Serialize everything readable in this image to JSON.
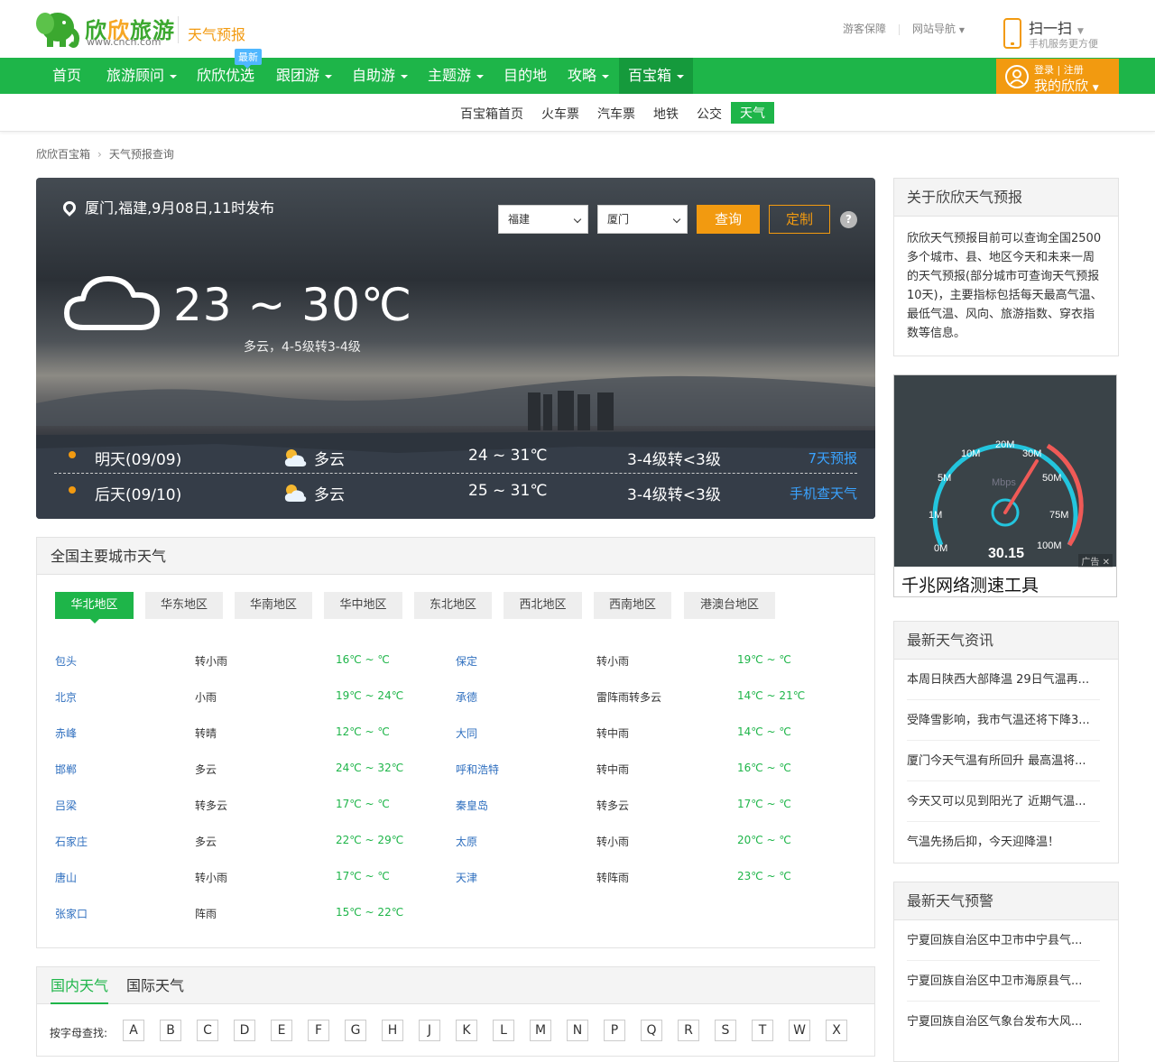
{
  "brand": {
    "name": "欣欣旅游",
    "url": "www.cncn.com",
    "section": "天气预报"
  },
  "top_links": [
    "游客保障",
    "网站导航"
  ],
  "scan": {
    "title": "扫一扫",
    "sub": "手机服务更方便"
  },
  "nav": {
    "items": [
      "首页",
      "旅游顾问",
      "欣欣优选",
      "跟团游",
      "自助游",
      "主题游",
      "目的地",
      "攻略",
      "百宝箱"
    ],
    "badge": "最新"
  },
  "login": {
    "line1": "登录 | 注册",
    "line2": "我的欣欣"
  },
  "subnav": [
    "百宝箱首页",
    "火车票",
    "汽车票",
    "地铁",
    "公交",
    "天气"
  ],
  "breadcrumb": [
    "欣欣百宝箱",
    "天气预报查询"
  ],
  "hero": {
    "location": "厦门,福建,9月08日,11时发布",
    "province": "福建",
    "city": "厦门",
    "query_label": "查询",
    "custom_label": "定制",
    "help": "?",
    "temp": "23 ~ 30℃",
    "desc": "多云，4-5级转3-4级",
    "forecast": [
      {
        "day": "明天(09/09)",
        "weather": "多云",
        "range": "24 ~ 31℃",
        "wind": "3-4级转<3级",
        "link": "7天预报"
      },
      {
        "day": "后天(09/10)",
        "weather": "多云",
        "range": "25 ~ 31℃",
        "wind": "3-4级转<3级",
        "link": "手机查天气"
      }
    ]
  },
  "city_panel": {
    "title": "全国主要城市天气",
    "tabs": [
      "华北地区",
      "华东地区",
      "华南地区",
      "华中地区",
      "东北地区",
      "西北地区",
      "西南地区",
      "港澳台地区"
    ],
    "rows": [
      [
        {
          "city": "包头",
          "weather": "转小雨",
          "temp": "16℃ ~ ℃"
        },
        {
          "city": "保定",
          "weather": "转小雨",
          "temp": "19℃ ~ ℃"
        }
      ],
      [
        {
          "city": "北京",
          "weather": "小雨",
          "temp": "19℃ ~ 24℃"
        },
        {
          "city": "承德",
          "weather": "雷阵雨转多云",
          "temp": "14℃ ~ 21℃"
        }
      ],
      [
        {
          "city": "赤峰",
          "weather": "转晴",
          "temp": "12℃ ~ ℃"
        },
        {
          "city": "大同",
          "weather": "转中雨",
          "temp": "14℃ ~ ℃"
        }
      ],
      [
        {
          "city": "邯郸",
          "weather": "多云",
          "temp": "24℃ ~ 32℃"
        },
        {
          "city": "呼和浩特",
          "weather": "转中雨",
          "temp": "16℃ ~ ℃"
        }
      ],
      [
        {
          "city": "吕梁",
          "weather": "转多云",
          "temp": "17℃ ~ ℃"
        },
        {
          "city": "秦皇岛",
          "weather": "转多云",
          "temp": "17℃ ~ ℃"
        }
      ],
      [
        {
          "city": "石家庄",
          "weather": "多云",
          "temp": "22℃ ~ 29℃"
        },
        {
          "city": "太原",
          "weather": "转小雨",
          "temp": "20℃ ~ ℃"
        }
      ],
      [
        {
          "city": "唐山",
          "weather": "转小雨",
          "temp": "17℃ ~ ℃"
        },
        {
          "city": "天津",
          "weather": "转阵雨",
          "temp": "23℃ ~ ℃"
        }
      ],
      [
        {
          "city": "张家口",
          "weather": "阵雨",
          "temp": "15℃ ~ 22℃"
        }
      ]
    ]
  },
  "bottom_panel": {
    "tabs": [
      "国内天气",
      "国际天气"
    ],
    "letter_label": "按字母查找:",
    "letters": [
      "A",
      "B",
      "C",
      "D",
      "E",
      "F",
      "G",
      "H",
      "J",
      "K",
      "L",
      "M",
      "N",
      "P",
      "Q",
      "R",
      "S",
      "T",
      "W",
      "X"
    ]
  },
  "sidebar": {
    "about": {
      "title": "关于欣欣天气预报",
      "text": "欣欣天气预报目前可以查询全国2500多个城市、县、地区今天和未来一周的天气预报(部分城市可查询天气预报10天)，主要指标包括每天最高气温、最低气温、风向、旅游指数、穿衣指数等信息。"
    },
    "ad": {
      "caption": "千兆网络测速工具",
      "tag": "广告",
      "speed": "30.15",
      "unit": "Mbps",
      "marks": [
        "0M",
        "1M",
        "5M",
        "10M",
        "20M",
        "30M",
        "50M",
        "75M",
        "100M"
      ]
    },
    "news": {
      "title": "最新天气资讯",
      "items": [
        "本周日陕西大部降温 29日气温再...",
        "受降雪影响，我市气温还将下降3...",
        "厦门今天气温有所回升 最高温将...",
        "今天又可以见到阳光了 近期气温...",
        "气温先扬后抑，今天迎降温！"
      ]
    },
    "alerts": {
      "title": "最新天气预警",
      "items": [
        "宁夏回族自治区中卫市中宁县气...",
        "宁夏回族自治区中卫市海原县气...",
        "宁夏回族自治区气象台发布大风..."
      ]
    }
  }
}
